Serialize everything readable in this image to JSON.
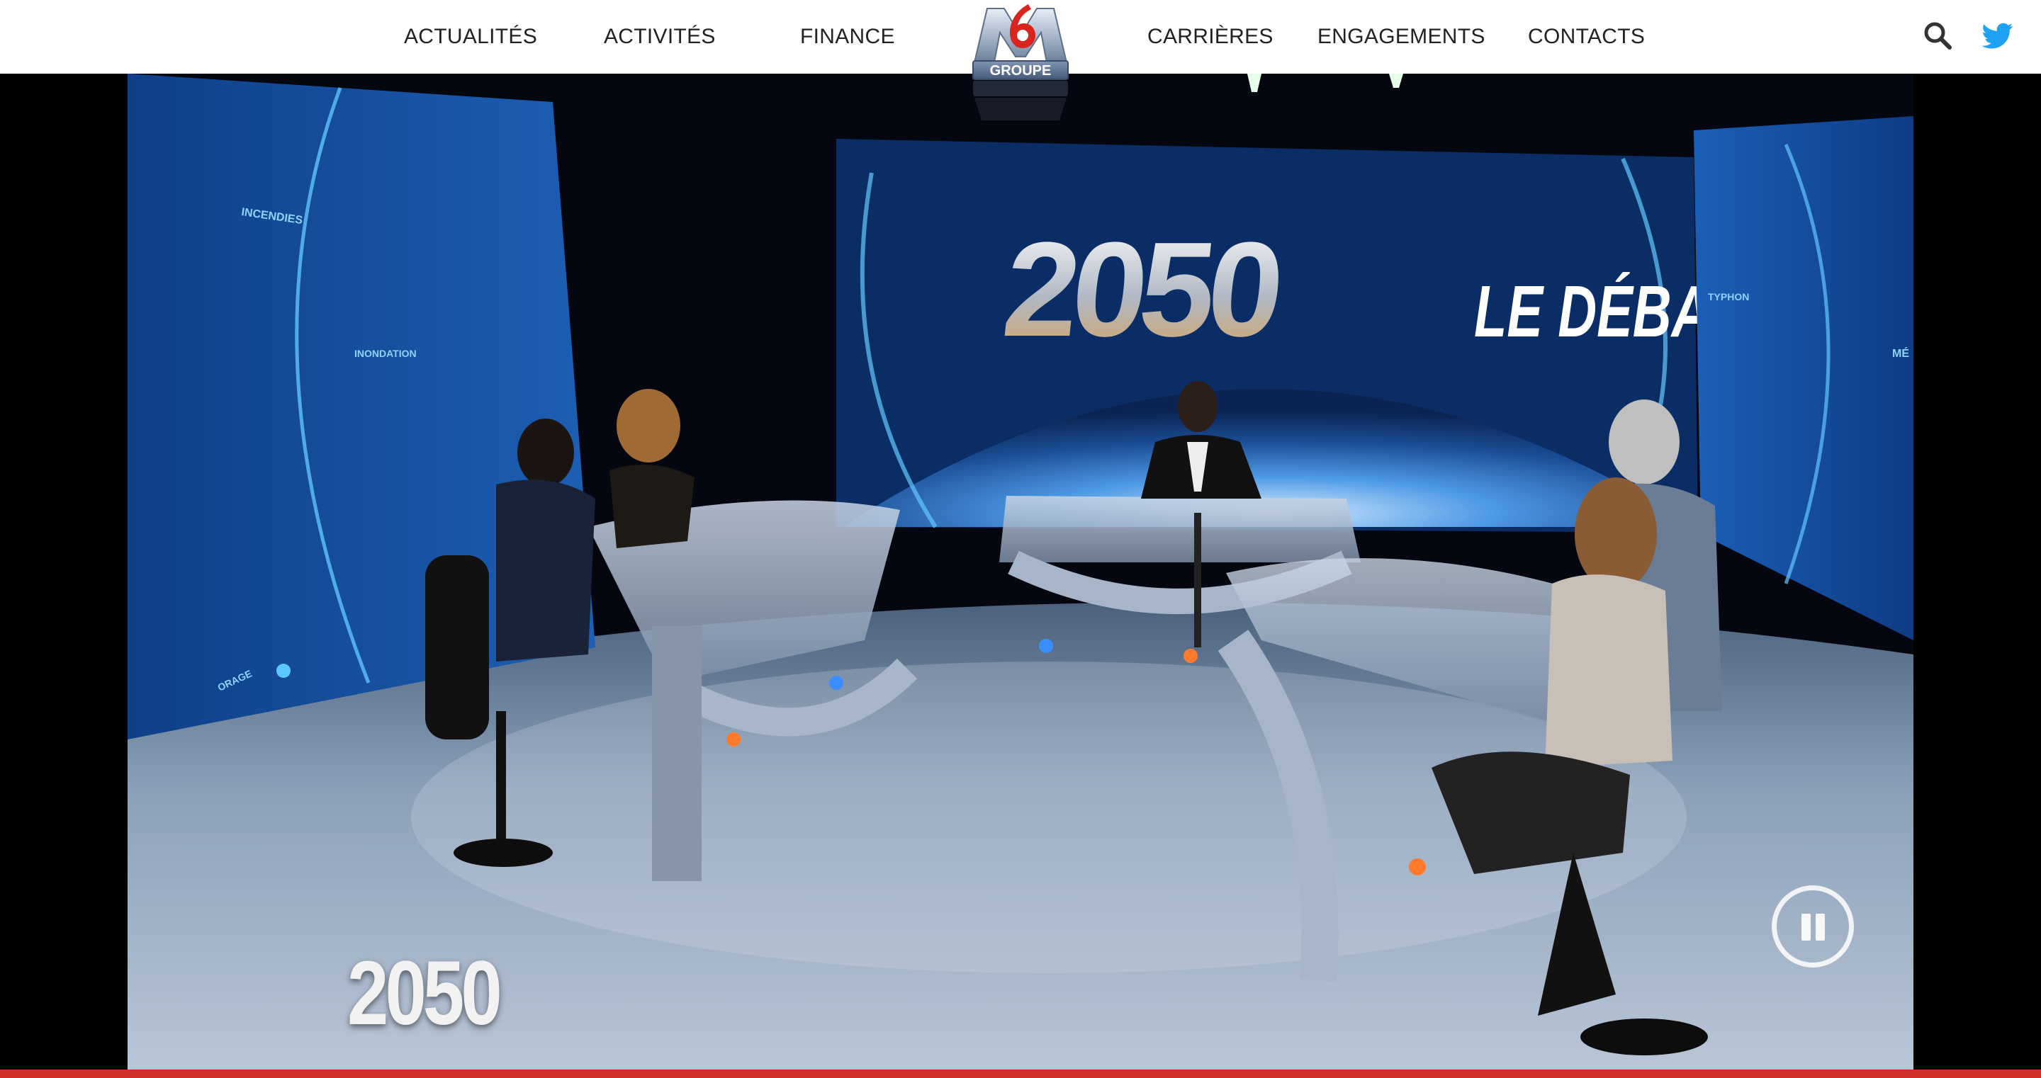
{
  "nav": {
    "left": [
      "ACTUALITÉS",
      "ACTIVITÉS",
      "FINANCE"
    ],
    "right": [
      "CARRIÈRES",
      "ENGAGEMENTS",
      "CONTACTS"
    ]
  },
  "logo": {
    "brand_text": "GROUPE",
    "brand_number": "6"
  },
  "icons": {
    "search": "search-icon",
    "twitter": "twitter-icon",
    "mute": "mute-icon",
    "pause": "pause-icon"
  },
  "video": {
    "show_title": "2050",
    "show_subtitle": "LE DÉBAT",
    "watermark": "2050",
    "screen_words": [
      "INCENDIES",
      "INONDATION",
      "ORAGE",
      "TYPHON",
      "MÉ"
    ],
    "progress": 1.0,
    "muted": true,
    "playing": true
  },
  "colors": {
    "twitter_blue": "#1da1f2",
    "progress_red": "#d0302b",
    "nav_text": "#222222"
  }
}
